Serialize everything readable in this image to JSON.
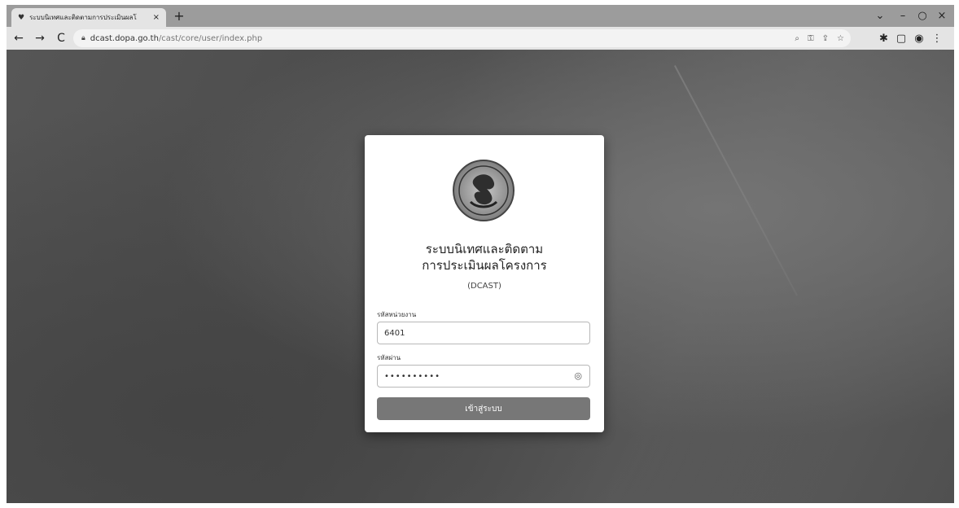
{
  "browser": {
    "tab_title": "ระบบนิเทศและติดตามการประเมินผลโ",
    "tab_close": "×",
    "new_tab": "+",
    "url_domain": "dcast.dopa.go.th",
    "url_path": "/cast/core/user/index.php",
    "window_controls": {
      "dropdown": "⌄",
      "minimize": "–",
      "restore": "○",
      "close": "×"
    }
  },
  "login": {
    "title_line1": "ระบบนิเทศและติดตาม",
    "title_line2": "การประเมินผลโครงการ",
    "subtitle": "(DCAST)",
    "unit_code_label": "รหัสหน่วยงาน",
    "unit_code_value": "6401",
    "password_label": "รหัสผ่าน",
    "password_value": "••••••••••",
    "submit_label": "เข้าสู่ระบบ"
  },
  "colors": {
    "button": "#777777",
    "page_background": "#555555",
    "card": "#ffffff"
  }
}
